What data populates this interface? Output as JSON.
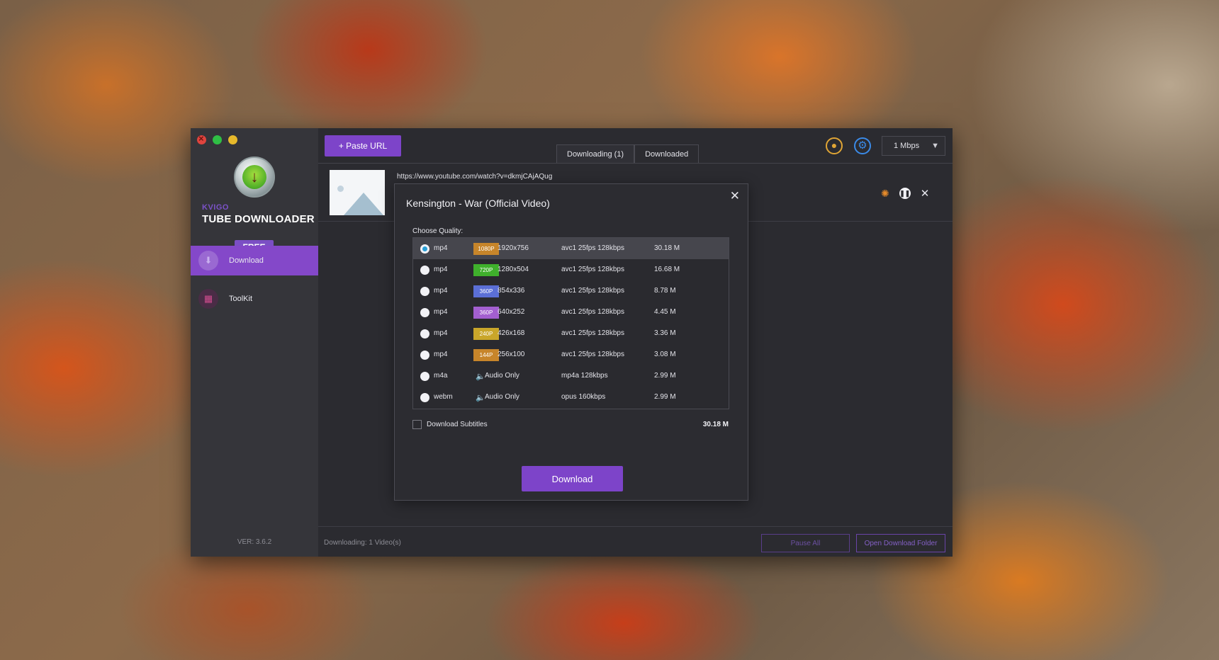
{
  "app": {
    "brand_small": "KVIGO",
    "brand_name": "TUBE DOWNLOADER",
    "plan_badge": "FREE",
    "version": "VER: 3.6.2"
  },
  "sidebar": {
    "items": [
      {
        "label": "Download",
        "icon": "download-icon",
        "active": true
      },
      {
        "label": "ToolKit",
        "icon": "grid-icon",
        "active": false
      }
    ]
  },
  "toolbar": {
    "paste_label": "+ Paste URL",
    "tabs": [
      {
        "label": "Downloading (1)",
        "active": true
      },
      {
        "label": "Downloaded",
        "active": false
      }
    ],
    "speed_value": "1 Mbps"
  },
  "download_item": {
    "url": "https://www.youtube.com/watch?v=dkmjCAjAQug"
  },
  "dialog": {
    "title": "Kensington - War (Official Video)",
    "choose_label": "Choose Quality:",
    "options": [
      {
        "format": "mp4",
        "badge": "1080P",
        "badge_color": "#c7852a",
        "resolution": "1920x756",
        "codec": "avc1 25fps 128kbps",
        "size": "30.18 M",
        "selected": true
      },
      {
        "format": "mp4",
        "badge": "720P",
        "badge_color": "#3fb02c",
        "resolution": "1280x504",
        "codec": "avc1 25fps 128kbps",
        "size": "16.68 M",
        "selected": false
      },
      {
        "format": "mp4",
        "badge": "360P",
        "badge_color": "#5b6fd6",
        "resolution": "854x336",
        "codec": "avc1 25fps 128kbps",
        "size": "8.78 M",
        "selected": false
      },
      {
        "format": "mp4",
        "badge": "360P",
        "badge_color": "#a35fd0",
        "resolution": "640x252",
        "codec": "avc1 25fps 128kbps",
        "size": "4.45 M",
        "selected": false
      },
      {
        "format": "mp4",
        "badge": "240P",
        "badge_color": "#c9a62a",
        "resolution": "426x168",
        "codec": "avc1 25fps 128kbps",
        "size": "3.36 M",
        "selected": false
      },
      {
        "format": "mp4",
        "badge": "144P",
        "badge_color": "#c7852a",
        "resolution": "256x100",
        "codec": "avc1 25fps 128kbps",
        "size": "3.08 M",
        "selected": false
      },
      {
        "format": "m4a",
        "badge": "",
        "badge_color": "",
        "resolution": "Audio Only",
        "codec": "mp4a 128kbps",
        "size": "2.99 M",
        "selected": false
      },
      {
        "format": "webm",
        "badge": "",
        "badge_color": "",
        "resolution": "Audio Only",
        "codec": "opus 160kbps",
        "size": "2.99 M",
        "selected": false
      }
    ],
    "subtitles_label": "Download Subtitles",
    "subtitles_checked": false,
    "total_size": "30.18 M",
    "download_label": "Download"
  },
  "footer": {
    "status": "Downloading: 1 Video(s)",
    "pause_all_label": "Pause All",
    "open_folder_label": "Open Download Folder"
  }
}
